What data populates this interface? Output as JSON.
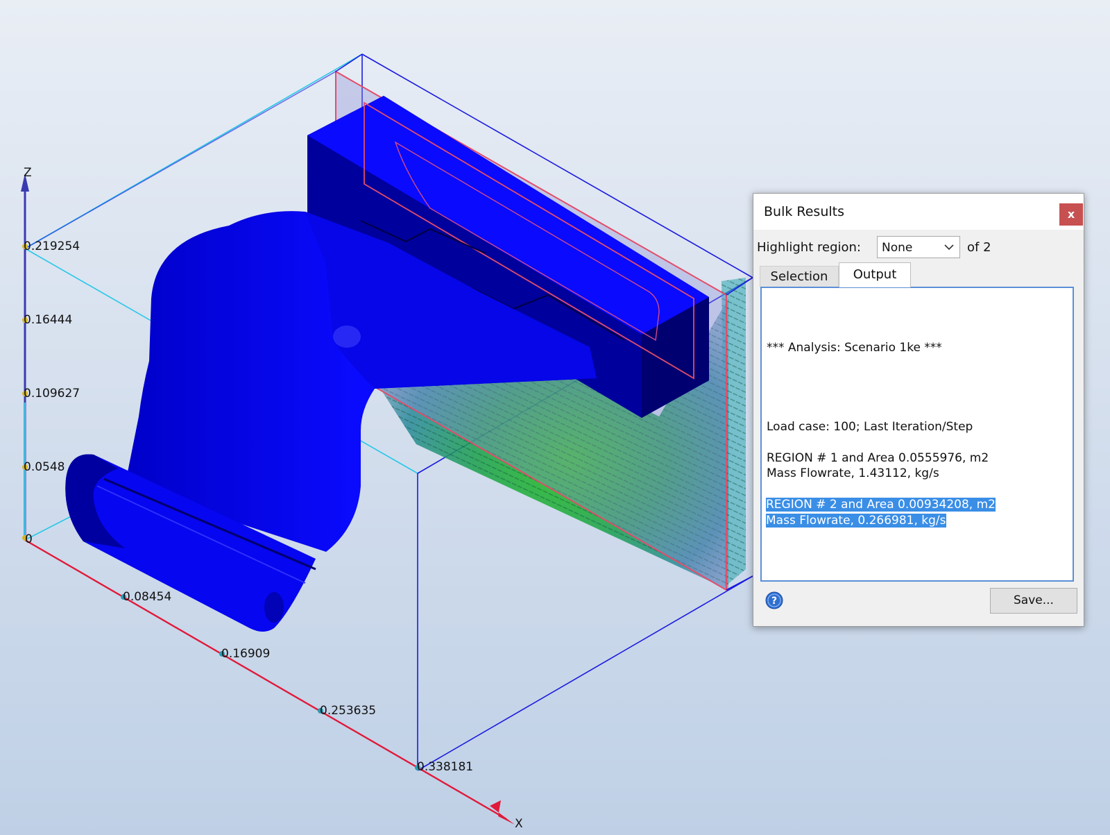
{
  "viewport": {
    "z_axis_label": "Z",
    "x_axis_label": "X",
    "z_ticks": [
      "0.219254",
      "0.16444",
      "0.109627",
      "0.0548"
    ],
    "z_origin_label": "0",
    "x_ticks": [
      "0.08454",
      "0.16909",
      "0.253635",
      "0.338181"
    ]
  },
  "dialog": {
    "title": "Bulk Results",
    "close_label": "x",
    "highlight_label": "Highlight region:",
    "highlight_value": "None",
    "of_count": "of 2",
    "tabs": [
      {
        "label": "Selection",
        "active": false
      },
      {
        "label": "Output",
        "active": true
      }
    ],
    "output": {
      "analysis_line": "*** Analysis: Scenario 1ke ***",
      "load_case": "Load case: 100; Last Iteration/Step",
      "region1_line1": "REGION # 1 and Area 0.0555976, m2",
      "region1_line2": "Mass Flowrate, 1.43112, kg/s",
      "region2_line1": "REGION # 2 and Area 0.00934208, m2",
      "region2_line2": "Mass Flowrate, 0.266981, kg/s"
    },
    "save_label": "Save..."
  },
  "colors": {
    "model_blue": "#0a0aff",
    "bounding_box": "#1a1ae0",
    "x_axis": "#e01a3a",
    "z_axis": "#3a3ab0",
    "selection_highlight": "#3a8ee6",
    "close_button": "#c75050"
  }
}
